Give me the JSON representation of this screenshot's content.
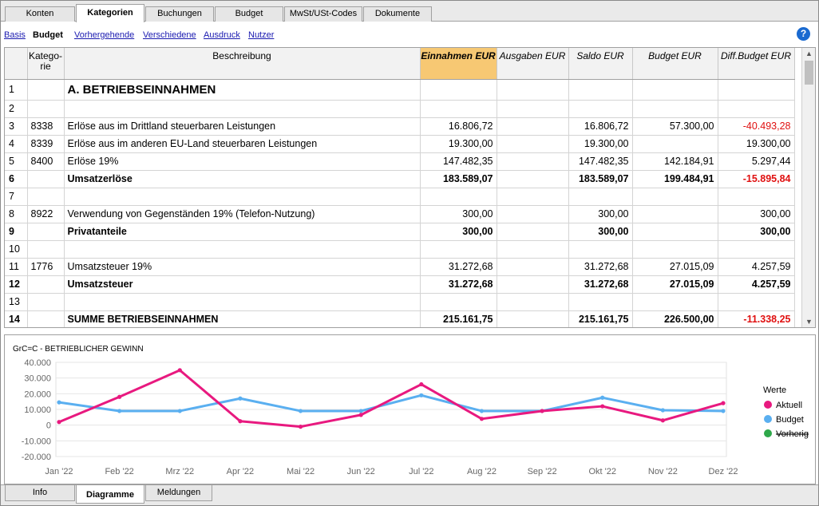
{
  "tabs": [
    "Konten",
    "Kategorien",
    "Buchungen",
    "Budget",
    "MwSt/USt-Codes",
    "Dokumente"
  ],
  "subnav": [
    "Basis",
    "Budget",
    "Vorhergehende",
    "Verschiedene",
    "Ausdruck",
    "Nutzer"
  ],
  "help_symbol": "?",
  "columns": [
    "",
    "Katego-rie",
    "Beschreibung",
    "Einnahmen EUR",
    "Ausgaben EUR",
    "Saldo EUR",
    "Budget EUR",
    "Diff.Budget EUR"
  ],
  "rows": [
    {
      "n": "1",
      "cat": "",
      "desc": "A. BETRIEBSEINNAHMEN",
      "ein": "",
      "aus": "",
      "saldo": "",
      "budget": "",
      "diff": ""
    },
    {
      "n": "2",
      "cat": "",
      "desc": "",
      "ein": "",
      "aus": "",
      "saldo": "",
      "budget": "",
      "diff": ""
    },
    {
      "n": "3",
      "cat": "8338",
      "desc": "Erlöse aus im Drittland steuerbaren Leistungen",
      "ein": "16.806,72",
      "aus": "",
      "saldo": "16.806,72",
      "budget": "57.300,00",
      "diff": "-40.493,28"
    },
    {
      "n": "4",
      "cat": "8339",
      "desc": "Erlöse aus im anderen EU-Land steuerbaren Leistungen",
      "ein": "19.300,00",
      "aus": "",
      "saldo": "19.300,00",
      "budget": "",
      "diff": "19.300,00"
    },
    {
      "n": "5",
      "cat": "8400",
      "desc": "Erlöse 19%",
      "ein": "147.482,35",
      "aus": "",
      "saldo": "147.482,35",
      "budget": "142.184,91",
      "diff": "5.297,44"
    },
    {
      "n": "6",
      "cat": "",
      "desc": "Umsatzerlöse",
      "ein": "183.589,07",
      "aus": "",
      "saldo": "183.589,07",
      "budget": "199.484,91",
      "diff": "-15.895,84"
    },
    {
      "n": "7",
      "cat": "",
      "desc": "",
      "ein": "",
      "aus": "",
      "saldo": "",
      "budget": "",
      "diff": ""
    },
    {
      "n": "8",
      "cat": "8922",
      "desc": "Verwendung von Gegenständen 19% (Telefon-Nutzung)",
      "ein": "300,00",
      "aus": "",
      "saldo": "300,00",
      "budget": "",
      "diff": "300,00"
    },
    {
      "n": "9",
      "cat": "",
      "desc": "Privatanteile",
      "ein": "300,00",
      "aus": "",
      "saldo": "300,00",
      "budget": "",
      "diff": "300,00"
    },
    {
      "n": "10",
      "cat": "",
      "desc": "",
      "ein": "",
      "aus": "",
      "saldo": "",
      "budget": "",
      "diff": ""
    },
    {
      "n": "11",
      "cat": "1776",
      "desc": "Umsatzsteuer 19%",
      "ein": "31.272,68",
      "aus": "",
      "saldo": "31.272,68",
      "budget": "27.015,09",
      "diff": "4.257,59"
    },
    {
      "n": "12",
      "cat": "",
      "desc": "Umsatzsteuer",
      "ein": "31.272,68",
      "aus": "",
      "saldo": "31.272,68",
      "budget": "27.015,09",
      "diff": "4.257,59"
    },
    {
      "n": "13",
      "cat": "",
      "desc": "",
      "ein": "",
      "aus": "",
      "saldo": "",
      "budget": "",
      "diff": ""
    },
    {
      "n": "14",
      "cat": "",
      "desc": "SUMME BETRIEBSEINNAHMEN",
      "ein": "215.161,75",
      "aus": "",
      "saldo": "215.161,75",
      "budget": "226.500,00",
      "diff": "-11.338,25"
    }
  ],
  "bold_rows": [
    "6",
    "9",
    "12",
    "14"
  ],
  "bottom_tabs": [
    "Info",
    "Diagramme",
    "Meldungen"
  ],
  "colors": {
    "accent_header": "#f7c873",
    "negative": "#e01010",
    "aktuell": "#e8197f",
    "budget": "#5aaff0",
    "vorherig": "#2ea84a"
  },
  "chart_data": {
    "type": "line",
    "title": "GrC=C - BETRIEBLICHER GEWINN",
    "categories": [
      "Jan '22",
      "Feb '22",
      "Mrz '22",
      "Apr '22",
      "Mai '22",
      "Jun '22",
      "Jul '22",
      "Aug '22",
      "Sep '22",
      "Okt '22",
      "Nov '22",
      "Dez '22"
    ],
    "yticks": [
      "-20.000",
      "-10.000",
      "0",
      "10.000",
      "20.000",
      "30.000",
      "40.000"
    ],
    "ylim": [
      -20000,
      40000
    ],
    "legend_title": "Werte",
    "legend_position": "right",
    "series": [
      {
        "name": "Aktuell",
        "values": [
          2000,
          18000,
          35000,
          2500,
          -1000,
          6500,
          26000,
          4000,
          9000,
          12000,
          3000,
          14000
        ]
      },
      {
        "name": "Budget",
        "values": [
          14500,
          9000,
          9000,
          17000,
          9000,
          9000,
          19000,
          9000,
          9000,
          17500,
          9500,
          9000
        ]
      },
      {
        "name": "Vorherig",
        "values": [],
        "struck": true
      }
    ]
  }
}
